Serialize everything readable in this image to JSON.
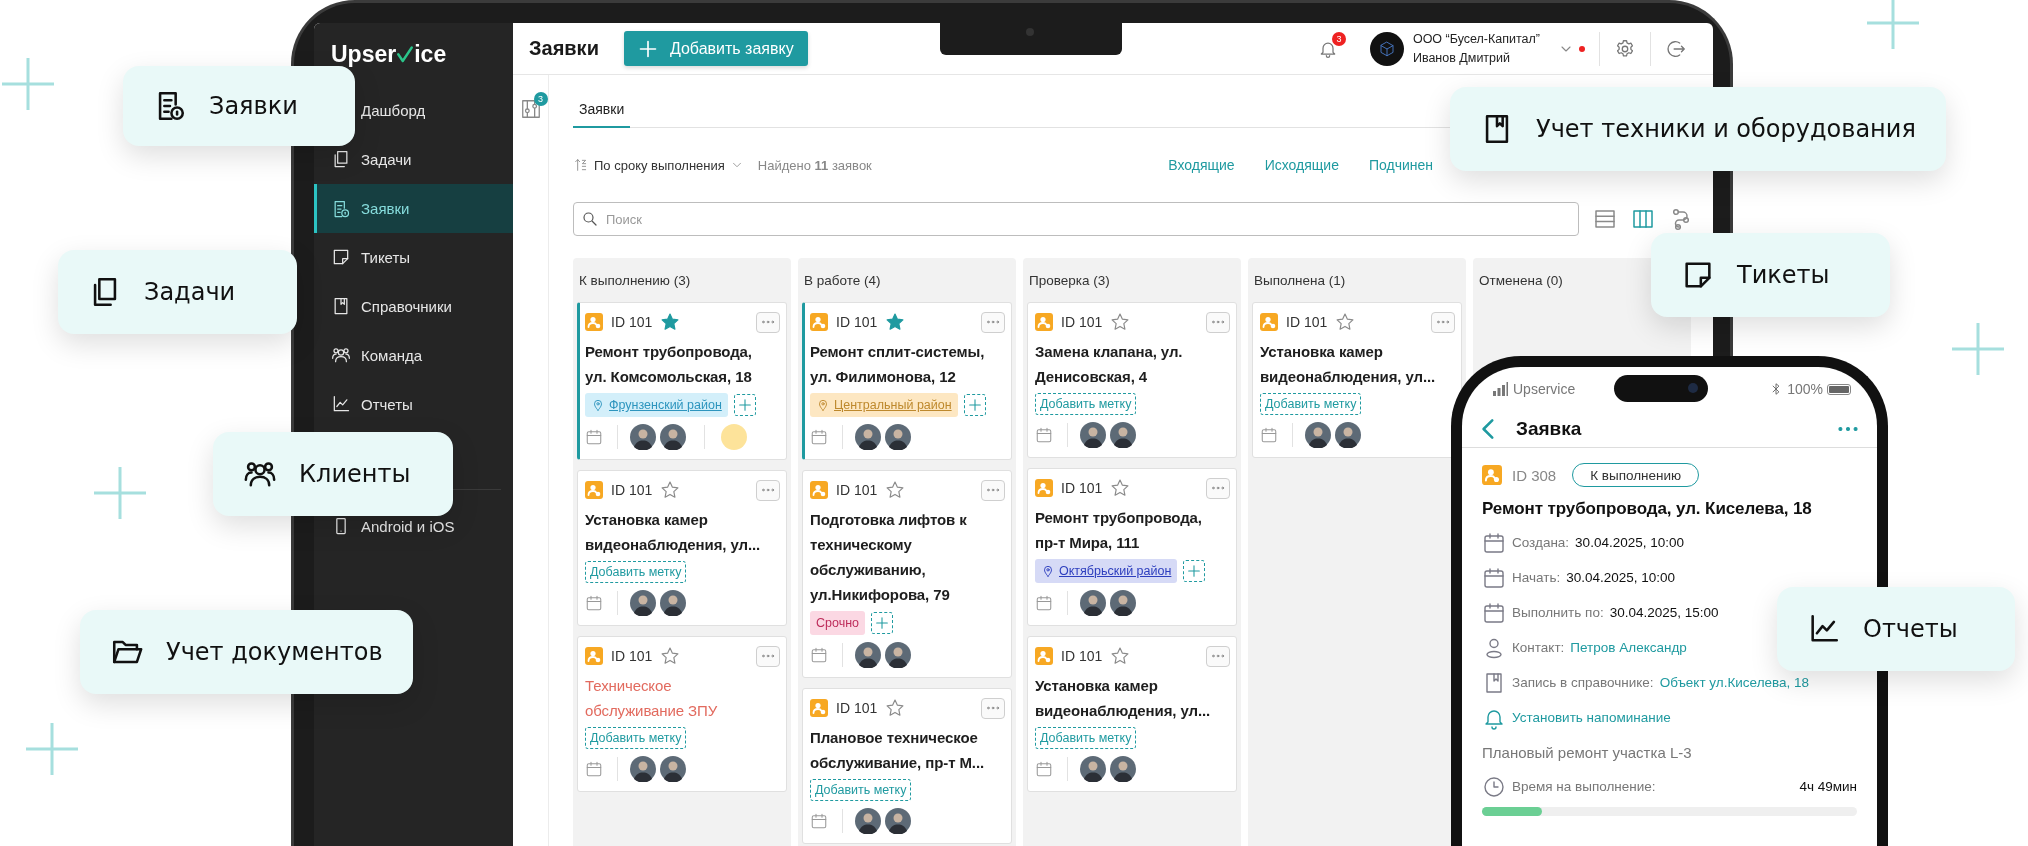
{
  "callouts": [
    {
      "label": "Заявки",
      "kind": "requests"
    },
    {
      "label": "Задачи",
      "kind": "tasks"
    },
    {
      "label": "Клиенты",
      "kind": "clients"
    },
    {
      "label": "Учет документов",
      "kind": "documents"
    },
    {
      "label": "Учет техники и оборудования",
      "kind": "equipment"
    },
    {
      "label": "Тикеты",
      "kind": "tickets"
    },
    {
      "label": "Отчеты",
      "kind": "reports"
    }
  ],
  "app": {
    "logo": {
      "before": "Upser",
      "after": "ice"
    },
    "sidebar": [
      {
        "label": "Дашборд",
        "kind": "dashboard",
        "selected": false
      },
      {
        "label": "Задачи",
        "kind": "tasks",
        "selected": false
      },
      {
        "label": "Заявки",
        "kind": "requests",
        "selected": true
      },
      {
        "label": "Тикеты",
        "kind": "tickets",
        "selected": false
      },
      {
        "label": "Справочники",
        "kind": "directory",
        "selected": false
      },
      {
        "label": "Команда",
        "kind": "team",
        "selected": false
      },
      {
        "label": "Отчеты",
        "kind": "reports",
        "selected": false
      }
    ],
    "sidebar_footer": [
      {
        "label": "Android и iOS",
        "kind": "mobile"
      }
    ],
    "header": {
      "title": "Заявки",
      "add_button": "Добавить заявку",
      "notifications": "3",
      "company": "ООО “Бусел-Капитал”",
      "user": "Иванов Дмитрий"
    },
    "filter_badge": "3",
    "tabs": [
      {
        "label": "Заявки",
        "selected": true
      }
    ],
    "sort": "По сроку выполнения",
    "found": "Найдено **11** заявок",
    "scope_links": [
      {
        "label": "Входящие"
      },
      {
        "label": "Исходящие"
      },
      {
        "label": "Подчинен"
      }
    ],
    "search": {
      "placeholder": "Поиск"
    },
    "views": [
      {
        "kind": "list",
        "selected": false
      },
      {
        "kind": "board",
        "selected": true
      },
      {
        "kind": "flow",
        "selected": false
      }
    ],
    "columns": [
      {
        "title": "К выполнению (3)",
        "cards": [
          {
            "id": "ID 101",
            "starred": true,
            "highlighted": true,
            "overdue": false,
            "title": "Ремонт трубопровода, ул. Комсомольская, 18",
            "tags": [
              {
                "kind": "location",
                "label": "Фрунзенский район",
                "color": "#d3effa"
              },
              {
                "kind": "plus"
              }
            ],
            "avatars": [
              {
                "kind": "photo"
              },
              {
                "kind": "photo"
              },
              {
                "kind": "guest"
              }
            ]
          },
          {
            "id": "ID 101",
            "starred": false,
            "highlighted": false,
            "overdue": false,
            "title": "Установка камер видеонаблюдения, ул...",
            "tags": [
              {
                "kind": "add",
                "label": "Добавить метку"
              }
            ],
            "avatars": [
              {
                "kind": "photo"
              },
              {
                "kind": "photo"
              }
            ]
          },
          {
            "id": "ID 101",
            "starred": false,
            "highlighted": false,
            "overdue": true,
            "title": "Техническое обслуживание ЗПУ",
            "tags": [
              {
                "kind": "add",
                "label": "Добавить метку"
              }
            ],
            "avatars": [
              {
                "kind": "photo"
              },
              {
                "kind": "photo"
              }
            ]
          }
        ]
      },
      {
        "title": "В работе (4)",
        "cards": [
          {
            "id": "ID 101",
            "starred": true,
            "highlighted": true,
            "overdue": false,
            "title": "Ремонт сплит-системы, ул. Филимонова, 12",
            "tags": [
              {
                "kind": "location",
                "label": "Центральный район",
                "color": "#fde7c2"
              },
              {
                "kind": "plus"
              }
            ],
            "avatars": [
              {
                "kind": "photo"
              },
              {
                "kind": "photo"
              }
            ]
          },
          {
            "id": "ID 101",
            "starred": false,
            "highlighted": false,
            "overdue": false,
            "title": "Подготовка лифтов к техническому обслуживанию, ул.Никифорова, 79",
            "tags": [
              {
                "kind": "label",
                "label": "Срочно",
                "color": "#fbd8e3"
              },
              {
                "kind": "plus"
              }
            ],
            "avatars": [
              {
                "kind": "photo"
              },
              {
                "kind": "photo"
              }
            ]
          },
          {
            "id": "ID 101",
            "starred": false,
            "highlighted": false,
            "overdue": false,
            "title": "Плановое техническое обслуживание, пр-т М...",
            "tags": [
              {
                "kind": "add",
                "label": "Добавить метку"
              }
            ],
            "avatars": [
              {
                "kind": "photo"
              },
              {
                "kind": "photo"
              }
            ]
          }
        ]
      },
      {
        "title": "Проверка (3)",
        "cards": [
          {
            "id": "ID 101",
            "starred": false,
            "highlighted": false,
            "overdue": false,
            "title": "Замена клапана, ул. Денисовская, 4",
            "tags": [
              {
                "kind": "add",
                "label": "Добавить метку"
              }
            ],
            "avatars": [
              {
                "kind": "photo"
              },
              {
                "kind": "photo"
              }
            ]
          },
          {
            "id": "ID 101",
            "starred": false,
            "highlighted": false,
            "overdue": false,
            "title": "Ремонт трубопровода, пр-т Мира, 111",
            "tags": [
              {
                "kind": "location",
                "label": "Октябрьский район",
                "color": "#d6daf6"
              },
              {
                "kind": "plus"
              }
            ],
            "avatars": [
              {
                "kind": "photo"
              },
              {
                "kind": "photo"
              }
            ]
          },
          {
            "id": "ID 101",
            "starred": false,
            "highlighted": false,
            "overdue": false,
            "title": "Установка камер видеонаблюдения, ул...",
            "tags": [
              {
                "kind": "add",
                "label": "Добавить метку"
              }
            ],
            "avatars": [
              {
                "kind": "photo"
              },
              {
                "kind": "photo"
              }
            ]
          }
        ]
      },
      {
        "title": "Выполнена (1)",
        "cards": [
          {
            "id": "ID 101",
            "starred": false,
            "highlighted": false,
            "overdue": false,
            "title": "Установка камер видеонаблюдения, ул...",
            "tags": [
              {
                "kind": "add",
                "label": "Добавить метку"
              }
            ],
            "avatars": [
              {
                "kind": "photo"
              },
              {
                "kind": "photo"
              }
            ]
          }
        ]
      },
      {
        "title": "Отменена (0)"
      }
    ]
  },
  "phone": {
    "carrier": "Upservice",
    "battery": "100%",
    "title": "Заявка",
    "id": "ID 308",
    "status": "К выполнению",
    "heading": "Ремонт трубопровода, ул. Киселева, 18",
    "fields": [
      {
        "kind": "date",
        "label": "Создана:",
        "value": "30.04.2025, 10:00",
        "link": false
      },
      {
        "kind": "date",
        "label": "Начать:",
        "value": "30.04.2025, 10:00",
        "link": false
      },
      {
        "kind": "date",
        "label": "Выполнить по:",
        "value": "30.04.2025, 15:00",
        "link": false
      },
      {
        "kind": "contact",
        "label": "Контакт:",
        "value": "Петров Александр",
        "link": true
      },
      {
        "kind": "record",
        "label": "Запись в справочнике:",
        "value": "Объект ул.Киселева, 18",
        "link": true
      }
    ],
    "reminder": "Установить напоминание",
    "description": "Плановый ремонт участка L-3",
    "time_label": "Время на выполнение:",
    "time_value": "4ч 49мин",
    "level": 0.16
  }
}
